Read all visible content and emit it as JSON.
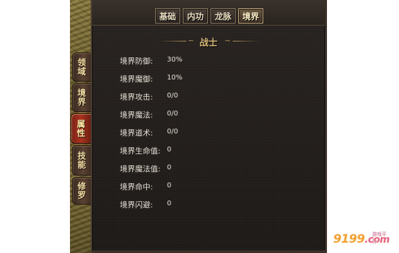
{
  "main_tabs": [
    {
      "label": "基础",
      "active": false
    },
    {
      "label": "内功",
      "active": false
    },
    {
      "label": "龙脉",
      "active": false
    },
    {
      "label": "境界",
      "active": true
    }
  ],
  "side_tabs": [
    {
      "label": "领域",
      "active": false
    },
    {
      "label": "境界",
      "active": false
    },
    {
      "label": "属性",
      "active": true
    },
    {
      "label": "技能",
      "active": false
    },
    {
      "label": "修罗",
      "active": false
    }
  ],
  "header": {
    "title": "战士"
  },
  "stats": [
    {
      "label": "境界防御:",
      "value": "30%"
    },
    {
      "label": "境界魔御:",
      "value": "10%"
    },
    {
      "label": "境界攻击:",
      "value": "0/0"
    },
    {
      "label": "境界魔法:",
      "value": "0/0"
    },
    {
      "label": "境界道术:",
      "value": "0/0"
    },
    {
      "label": "境界生命值:",
      "value": "0"
    },
    {
      "label": "境界魔法值:",
      "value": "0"
    },
    {
      "label": "境界命中:",
      "value": "0"
    },
    {
      "label": "境界闪避:",
      "value": "0"
    }
  ],
  "watermark": {
    "brand": "9199",
    "domain": ".com",
    "tagline": "游戏平台"
  },
  "colors": {
    "panel_bg": "#231f1c",
    "title_gold": "#d8b878",
    "active_side_tab": "#a8321e",
    "watermark_orange": "#f2a23a"
  }
}
